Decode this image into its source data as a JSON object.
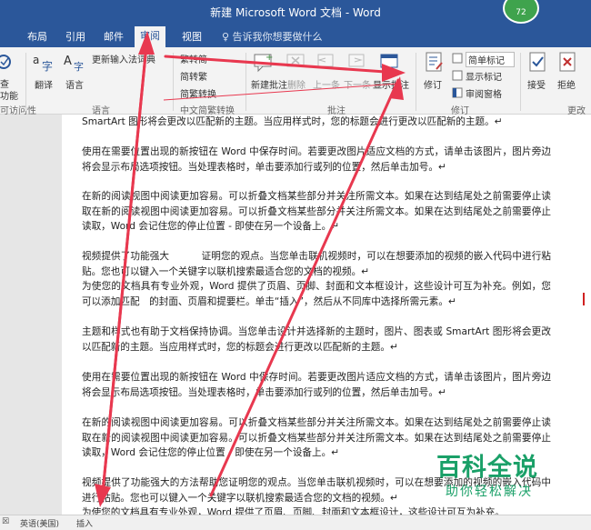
{
  "window": {
    "title": "新建 Microsoft Word 文档  -  Word",
    "badge": "72"
  },
  "tabs": [
    {
      "label": "布局"
    },
    {
      "label": "引用"
    },
    {
      "label": "邮件"
    },
    {
      "label": "审阅"
    },
    {
      "label": "视图"
    }
  ],
  "tellme": "♀ 告诉我你想要做什么",
  "ribbon": {
    "left_cut": {
      "line1": "查",
      "line2": "功能",
      "group": "可访问性"
    },
    "language": {
      "translate": "翻译",
      "language": "语言",
      "update_input": "更新输入法词典",
      "group": "语言"
    },
    "chinese_conv": {
      "to_trad": "繁转简",
      "to_simp": "简转繁",
      "conv": "简繁转换",
      "group": "中文简繁转换"
    },
    "comments": {
      "new": "新建批注",
      "delete": "删除",
      "prev": "上一条",
      "next": "下一条",
      "show": "显示批注",
      "group": "批注"
    },
    "tracking": {
      "track": "修订",
      "markup": "简单标记",
      "show_markup": "显示标记",
      "pane": "审阅窗格",
      "group": "修订"
    },
    "changes": {
      "accept": "接受",
      "reject": "拒绝",
      "group": "更改"
    }
  },
  "document": {
    "paragraphs": [
      "SmartArt 图形将会更改以匹配新的主题。当应用样式时，您的标题会进行更改以匹配新的主题。↵",
      "使用在需要位置出现的新按钮在 Word 中保存时间。若要更改图片适应文档的方式，请单击该图片，图片旁边将会显示布局选项按钮。当处理表格时，单击要添加行或列的位置，然后单击加号。↵",
      "在新的阅读视图中阅读更加容易。可以折叠文档某些部分并关注所需文本。如果在达到结尾处之前需要停止读取在新的阅读视图中阅读更加容易。可以折叠文档某些部分并关注所需文本。如果在达到结尾处之前需要停止读取，Word 会记住您的停止位置 - 即使在另一个设备上。↵",
      "视频提供了功能强大 　　　证明您的观点。当您单击联机视频时，可以在想要添加的视频的嵌入代码中进行粘贴。您也可以键入一个关键字以联机搜索最适合您的文档的视频。↵",
      "为使您的文档具有专业外观，Word 提供了页眉、页脚、封面和文本框设计，这些设计可互为补充。例如，您可以添加匹配　的封面、页眉和提要栏。单击“插入”，然后从不同库中选择所需元素。↵",
      "主题和样式也有助于文档保持协调。当您单击设计并选择新的主题时，图片、图表或 SmartArt 图形将会更改以匹配新的主题。当应用样式时，您的标题会进行更改以匹配新的主题。↵",
      "使用在需要位置出现的新按钮在 Word 中保存时间。若要更改图片适应文档的方式，请单击该图片，图片旁边将会显示布局选项按钮。当处理表格时，单击要添加行或列的位置，然后单击加号。↵",
      "在新的阅读视图中阅读更加容易。可以折叠文档某些部分并关注所需文本。如果在达到结尾处之前需要停止读取在新的阅读视图中阅读更加容易。可以折叠文档某些部分并关注所需文本。如果在达到结尾处之前需要停止读取，Word 会记住您的停止位置 - 即使在另一个设备上。↵",
      "视频提供了功能强大的方法帮助您证明您的观点。当您单击联机视频时，可以在想要添加的视频的嵌入代码中进行粘贴。您也可以键入一个关键字以联机搜索最适合您的文档的视频。↵",
      "为使您的文档具有专业外观，Word 提供了页眉、页脚、封面和文本框设计，这些设计可互为补充。"
    ]
  },
  "status": {
    "page_icon": "☒",
    "language": "英语(美国)",
    "mode": "插入"
  },
  "watermark": {
    "main": "百科全说",
    "sub": "助你轻松解决"
  },
  "colors": {
    "accent": "#2b579a",
    "arrow": "#e8384f",
    "watermark": "#1aa068"
  }
}
